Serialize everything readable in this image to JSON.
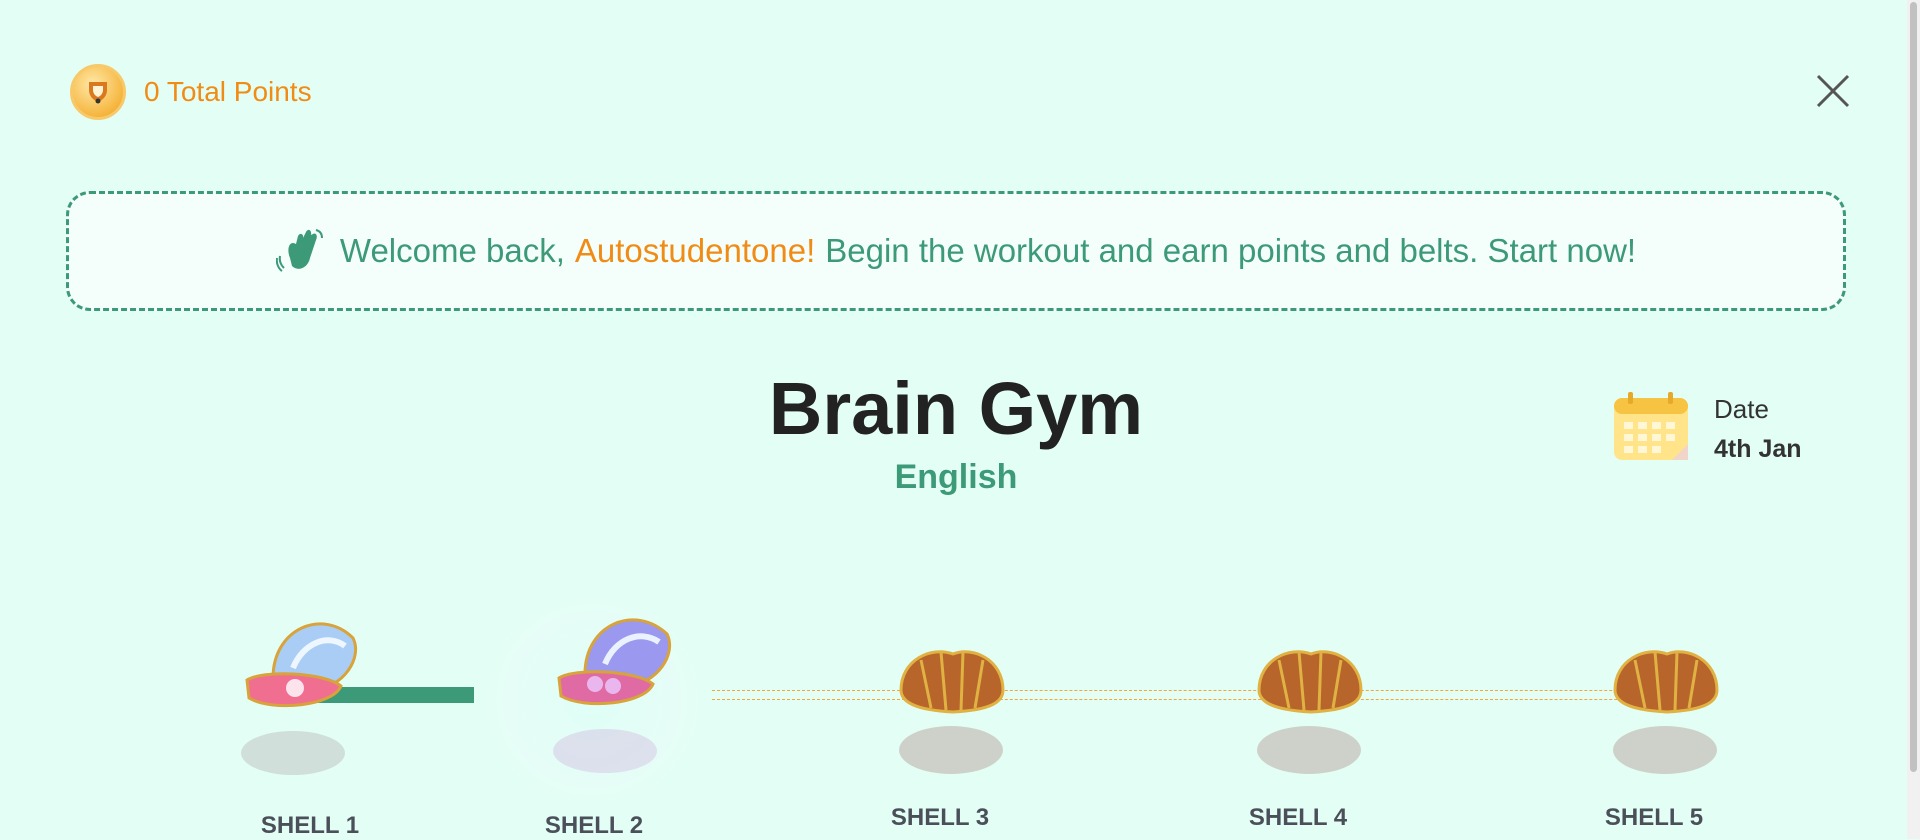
{
  "header": {
    "points_text": "0 Total Points",
    "coin_icon": "trophy-coin-icon",
    "close_icon": "close-icon"
  },
  "banner": {
    "wave_icon": "waving-hand-icon",
    "greeting": "Welcome back,",
    "name": "Autostudentone!",
    "message": "Begin the workout and earn points and belts. Start now!"
  },
  "main": {
    "title": "Brain Gym",
    "subject": "English"
  },
  "date": {
    "icon": "calendar-icon",
    "label": "Date",
    "value": "4th Jan"
  },
  "shells": [
    {
      "label": "SHELL 1",
      "state": "open-pearl"
    },
    {
      "label": "SHELL 2",
      "state": "open-pearl-current"
    },
    {
      "label": "SHELL 3",
      "state": "closed"
    },
    {
      "label": "SHELL 4",
      "state": "closed"
    },
    {
      "label": "SHELL 5",
      "state": "closed"
    }
  ],
  "colors": {
    "background": "#e3fff5",
    "accent_green": "#3d9a78",
    "accent_orange": "#f08c16"
  }
}
